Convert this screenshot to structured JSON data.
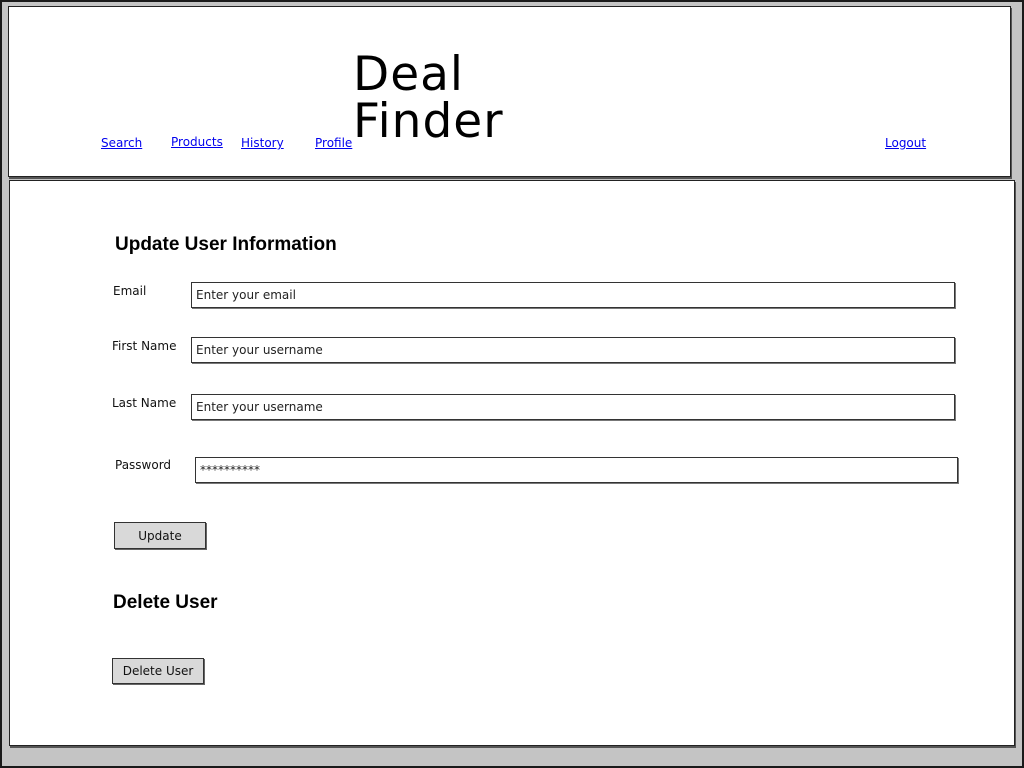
{
  "header": {
    "app_title": "Deal Finder",
    "nav": {
      "search": "Search",
      "products": "Products",
      "history": "History",
      "profile": "Profile",
      "logout": "Logout"
    }
  },
  "update_section": {
    "title": "Update User Information",
    "fields": {
      "email": {
        "label": "Email",
        "placeholder": "Enter your email",
        "value": ""
      },
      "first_name": {
        "label": "First Name",
        "placeholder": "Enter your username",
        "value": ""
      },
      "last_name": {
        "label": "Last Name",
        "placeholder": "Enter your username",
        "value": ""
      },
      "password": {
        "label": "Password",
        "value": "**********"
      }
    },
    "update_button": "Update"
  },
  "delete_section": {
    "title": "Delete User",
    "delete_button": "Delete User"
  }
}
